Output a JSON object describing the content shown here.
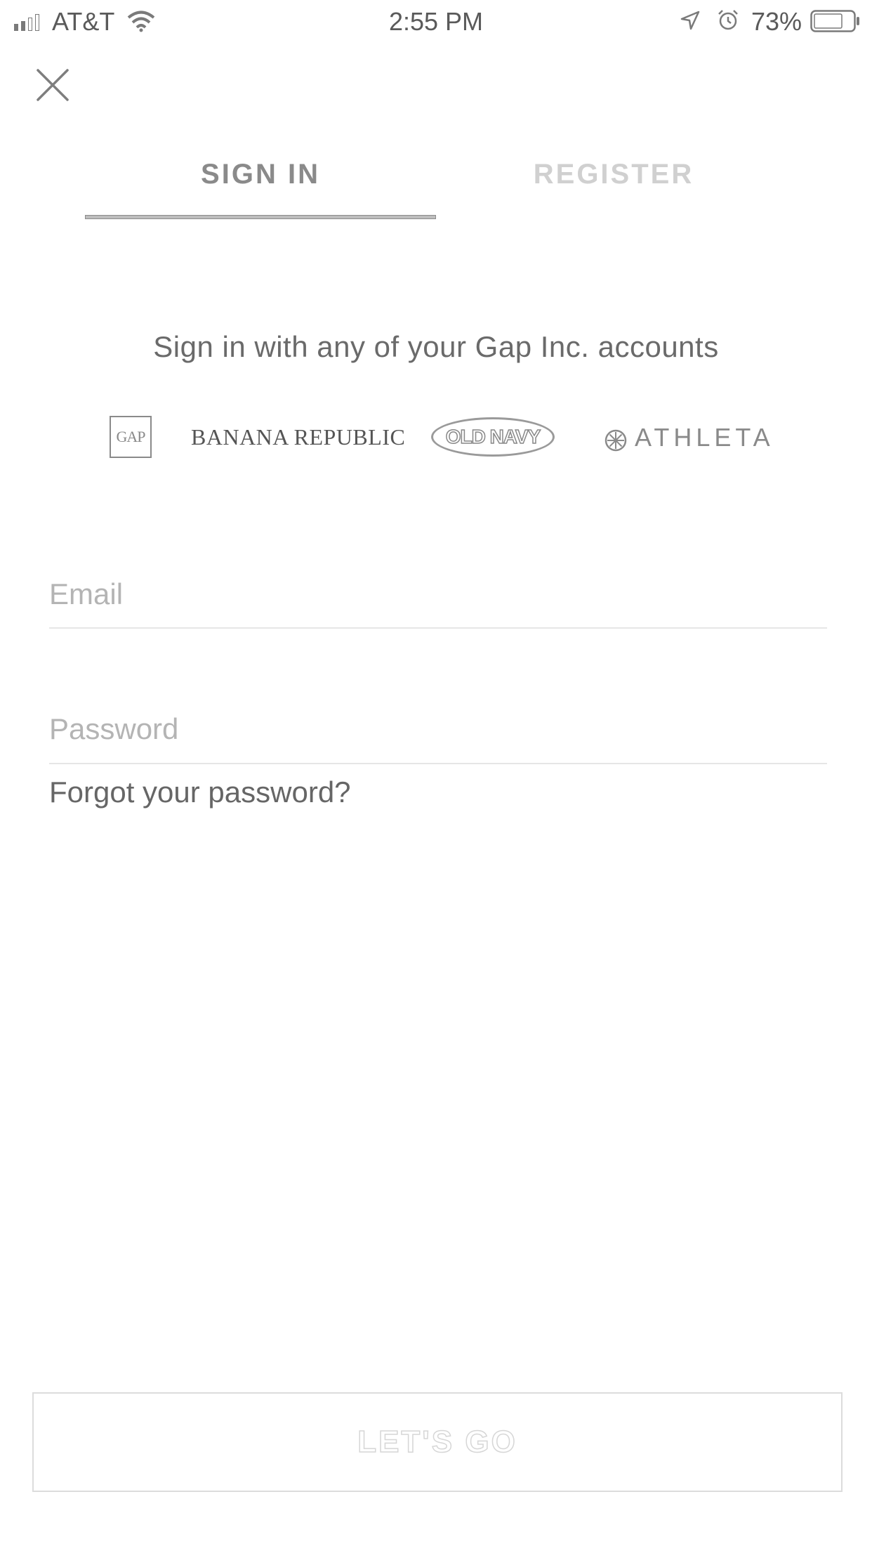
{
  "status_bar": {
    "carrier": "AT&T",
    "time": "2:55 PM",
    "battery": "73%",
    "signal_bars_filled": 2,
    "signal_bars_total": 4,
    "battery_level": 0.73,
    "icons": [
      "signal-icon",
      "wifi-icon",
      "location-icon",
      "alarm-icon",
      "battery-icon"
    ]
  },
  "close_icon": "close-icon",
  "tabs": {
    "sign_in": "SIGN IN",
    "register": "REGISTER",
    "active": "sign_in"
  },
  "subtitle": "Sign in with any of your Gap Inc. accounts",
  "brands": {
    "gap": "GAP",
    "banana_republic": "BANANA REPUBLIC",
    "old_navy": "OLD NAVY",
    "athleta": "ATHLETA"
  },
  "form": {
    "email_placeholder": "Email",
    "email_value": "",
    "password_placeholder": "Password",
    "password_value": "",
    "forgot_password": "Forgot your password?"
  },
  "submit_label": "LET'S GO",
  "colors": {
    "active_tab": "#8a8a8a",
    "inactive_tab": "#d0d0d0",
    "placeholder": "#b4b4b4",
    "disabled_button": "#d6d6d6"
  }
}
